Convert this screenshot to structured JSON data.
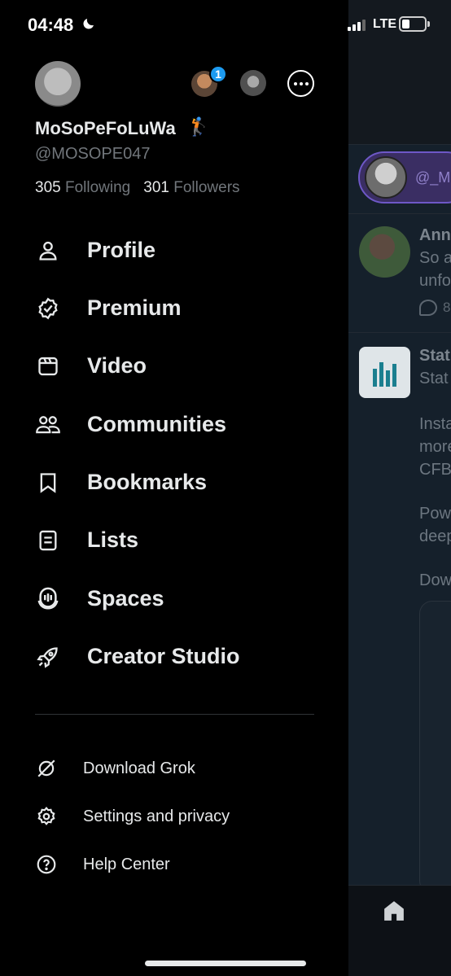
{
  "status_bar": {
    "time": "04:48",
    "network": "LTE",
    "battery_level": 0.35
  },
  "profile": {
    "display_name": "MoSoPeFoLuWa",
    "name_emoji": "🏌️",
    "handle": "@MOSOPE047",
    "following_count": "305",
    "following_label": "Following",
    "followers_count": "301",
    "followers_label": "Followers",
    "notification_badge": "1"
  },
  "menu": {
    "items": [
      {
        "label": "Profile",
        "icon": "person-icon"
      },
      {
        "label": "Premium",
        "icon": "verified-badge-icon"
      },
      {
        "label": "Video",
        "icon": "video-icon"
      },
      {
        "label": "Communities",
        "icon": "communities-icon"
      },
      {
        "label": "Bookmarks",
        "icon": "bookmark-icon"
      },
      {
        "label": "Lists",
        "icon": "list-icon"
      },
      {
        "label": "Spaces",
        "icon": "spaces-icon"
      },
      {
        "label": "Creator Studio",
        "icon": "rocket-icon"
      }
    ],
    "secondary": [
      {
        "label": "Download Grok",
        "icon": "grok-icon"
      },
      {
        "label": "Settings and privacy",
        "icon": "gear-icon"
      },
      {
        "label": "Help Center",
        "icon": "help-icon"
      }
    ]
  },
  "background_feed": {
    "pill_text": "@_M",
    "post1": {
      "name": "Ann",
      "line1": "So a",
      "line2": "unfo",
      "reply_count": "8"
    },
    "post2": {
      "name": "Stat",
      "line1": "Stat",
      "line2": "Insta",
      "line3": "more",
      "line4": "CFB",
      "line5": "Pow",
      "line6": "deep",
      "line7": "Dow"
    }
  },
  "colors": {
    "accent": "#1d9bf0",
    "background": "#000000",
    "text": "#e7e9ea",
    "muted": "#71767b"
  }
}
